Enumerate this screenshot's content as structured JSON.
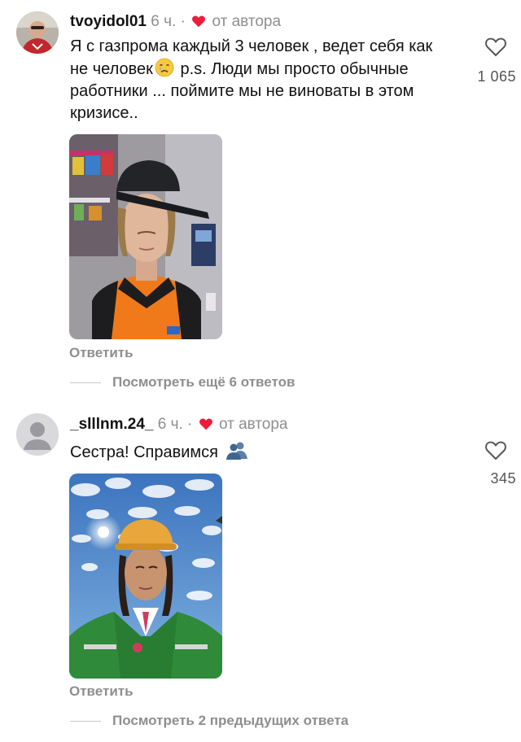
{
  "comments": [
    {
      "username": "tvoyidol01",
      "time": "6 ч. ·",
      "author_tag": "от автора",
      "text_part1": "Я с газпрома каждый 3 человек , ведет себя как не человек",
      "text_part2": " p.s. Люди мы просто обычные работники ... поймите мы не виноваты в этом кризисе..",
      "emoji_icon": "crying-face-icon",
      "likes": "1 065",
      "reply_label": "Ответить",
      "more_label": "Посмотреть ещё 6 ответов"
    },
    {
      "username": "_slllnm.24_",
      "time": "6 ч. ·",
      "author_tag": "от автора",
      "text_part1": "Сестра! Справимся",
      "emoji_icon": "people-silhouette-icon",
      "likes": "345",
      "reply_label": "Ответить",
      "more_label": "Посмотреть 2 предыдущих ответа"
    }
  ],
  "colors": {
    "heart_red": "#ed1c3a",
    "meta_gray": "#8e8e8e",
    "uniform_orange": "#f07a1a",
    "uniform_green": "#2f9a3a",
    "sky_blue": "#4f86c9"
  }
}
